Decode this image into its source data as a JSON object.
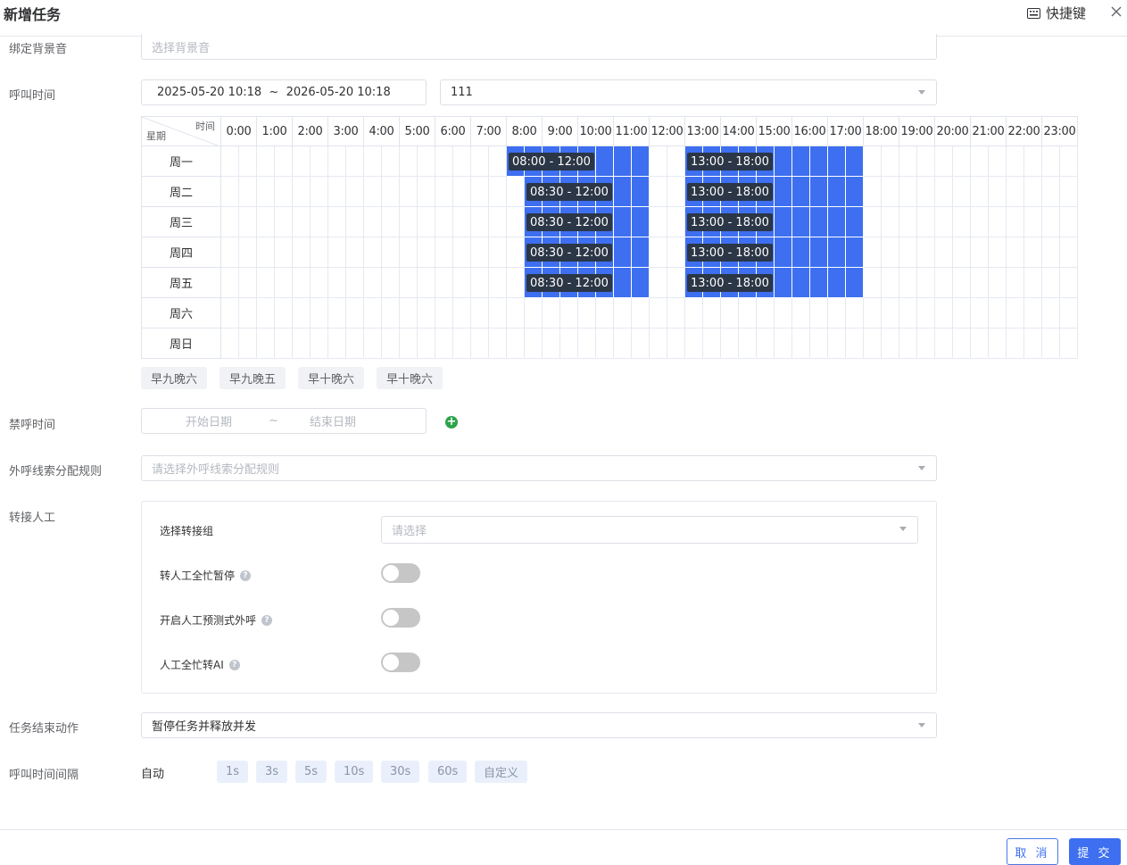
{
  "header": {
    "title": "新增任务",
    "shortcut_label": "快捷键"
  },
  "form": {
    "bgm_label": "绑定背景音",
    "bgm_placeholder": "选择背景音",
    "call_time_label": "呼叫时间",
    "date_range": "2025-05-20 10:18  ~  2026-05-20 10:18",
    "template_value": "111",
    "schedule": {
      "corner_time": "时间",
      "corner_week": "星期",
      "hours": [
        "0:00",
        "1:00",
        "2:00",
        "3:00",
        "4:00",
        "5:00",
        "6:00",
        "7:00",
        "8:00",
        "9:00",
        "10:00",
        "11:00",
        "12:00",
        "13:00",
        "14:00",
        "15:00",
        "16:00",
        "17:00",
        "18:00",
        "19:00",
        "20:00",
        "21:00",
        "22:00",
        "23:00"
      ],
      "days": [
        "周一",
        "周二",
        "周三",
        "周四",
        "周五",
        "周六",
        "周日"
      ],
      "slots": [
        {
          "day": 0,
          "ranges": [
            {
              "start": 8.0,
              "end": 12.0,
              "label": "08:00 - 12:00"
            },
            {
              "start": 13.0,
              "end": 18.0,
              "label": "13:00 - 18:00"
            }
          ]
        },
        {
          "day": 1,
          "ranges": [
            {
              "start": 8.5,
              "end": 12.0,
              "label": "08:30 - 12:00"
            },
            {
              "start": 13.0,
              "end": 18.0,
              "label": "13:00 - 18:00"
            }
          ]
        },
        {
          "day": 2,
          "ranges": [
            {
              "start": 8.5,
              "end": 12.0,
              "label": "08:30 - 12:00"
            },
            {
              "start": 13.0,
              "end": 18.0,
              "label": "13:00 - 18:00"
            }
          ]
        },
        {
          "day": 3,
          "ranges": [
            {
              "start": 8.5,
              "end": 12.0,
              "label": "08:30 - 12:00"
            },
            {
              "start": 13.0,
              "end": 18.0,
              "label": "13:00 - 18:00"
            }
          ]
        },
        {
          "day": 4,
          "ranges": [
            {
              "start": 8.5,
              "end": 12.0,
              "label": "08:30 - 12:00"
            },
            {
              "start": 13.0,
              "end": 18.0,
              "label": "13:00 - 18:00"
            }
          ]
        }
      ],
      "presets": [
        "早九晚六",
        "早九晚五",
        "早十晚六",
        "早十晚六"
      ]
    },
    "dnd_label": "禁呼时间",
    "dnd_start_placeholder": "开始日期",
    "dnd_separator": "~",
    "dnd_end_placeholder": "结束日期",
    "lead_rule_label": "外呼线索分配规则",
    "lead_rule_placeholder": "请选择外呼线索分配规则",
    "transfer_label": "转接人工",
    "transfer": {
      "group_label": "选择转接组",
      "group_placeholder": "请选择",
      "busy_pause_label": "转人工全忙暂停",
      "predictive_label": "开启人工预测式外呼",
      "busy_to_ai_label": "人工全忙转AI",
      "help_glyph": "?"
    },
    "end_action_label": "任务结束动作",
    "end_action_value": "暂停任务并释放并发",
    "interval_label": "呼叫时间间隔",
    "interval_auto": "自动",
    "interval_options": [
      "1s",
      "3s",
      "5s",
      "10s",
      "30s",
      "60s",
      "自定义"
    ]
  },
  "footer": {
    "cancel_label": "取 消",
    "submit_label": "提 交"
  },
  "colors": {
    "accent": "#3d6ff0",
    "slot_label_bg": "#2b3646",
    "add_green": "#2ca44b"
  }
}
